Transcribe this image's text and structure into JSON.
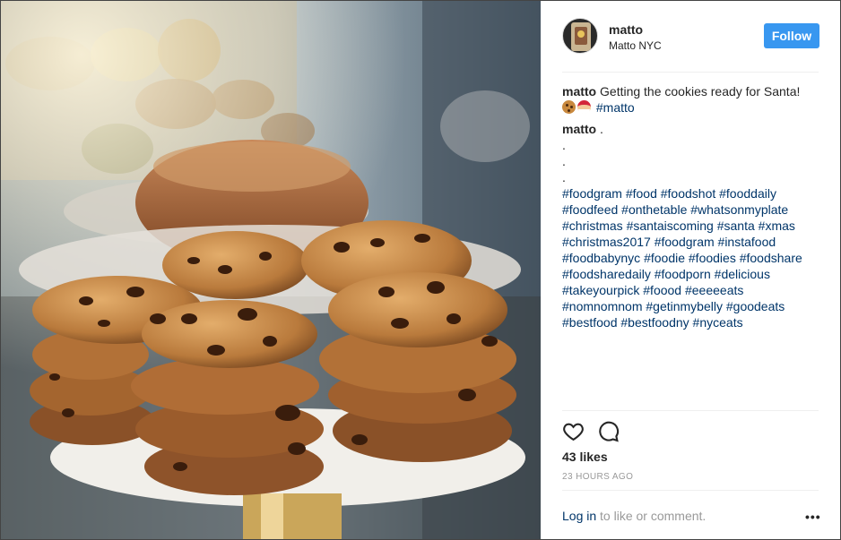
{
  "header": {
    "username": "matto",
    "location": "Matto NYC",
    "follow_label": "Follow"
  },
  "caption": {
    "username": "matto",
    "text": "Getting the cookies ready for Santa!",
    "emojis": [
      "cookie",
      "santa"
    ],
    "hashtag": "#matto"
  },
  "comment": {
    "username": "matto",
    "dot_lines": [
      ".",
      ".",
      ".",
      "."
    ],
    "hashtags": "#foodgram #food #foodshot #fooddaily #foodfeed #onthetable #whatsonmyplate #christmas #santaiscoming #santa #xmas #christmas2017 #foodgram #instafood #foodbabynyc #foodie #foodies #foodshare #foodsharedaily #foodporn #delicious #takeyourpick #foood #eeeeeats #nomnomnom #getinmybelly #goodeats #bestfood #bestfoodny #nyceats"
  },
  "actions": {
    "like_icon": "heart-icon",
    "comment_icon": "comment-icon"
  },
  "likes": "43 likes",
  "timestamp": "23 HOURS AGO",
  "footer": {
    "login_link": "Log in",
    "login_rest": " to like or comment.",
    "more_label": "•••"
  }
}
